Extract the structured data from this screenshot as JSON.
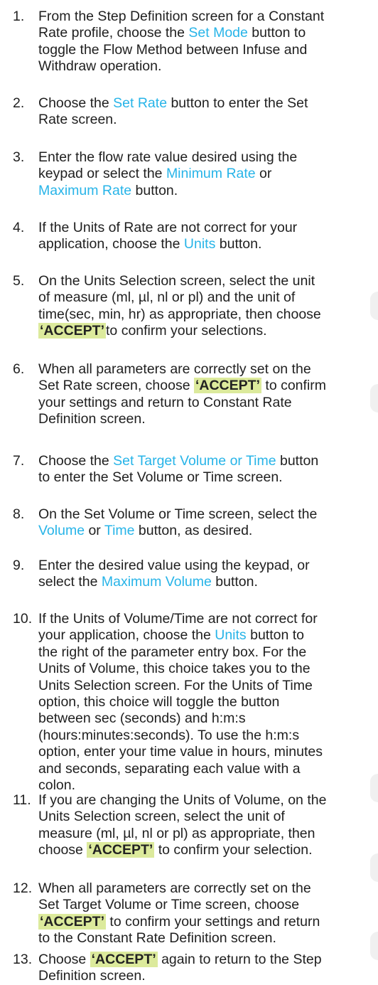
{
  "steps": [
    {
      "num": "1.",
      "lines": [
        [
          {
            "t": "From the Step Definition screen for a Constant"
          }
        ],
        [
          {
            "t": "Rate profile, choose the "
          },
          {
            "t": "Set Mode",
            "k": "link"
          },
          {
            "t": " button to"
          }
        ],
        [
          {
            "t": "toggle the Flow Method between Infuse and"
          }
        ],
        [
          {
            "t": "Withdraw operation."
          }
        ]
      ]
    },
    {
      "num": "2.",
      "lines": [
        [
          {
            "t": "Choose the "
          },
          {
            "t": "Set Rate",
            "k": "link"
          },
          {
            "t": " button to enter the Set"
          }
        ],
        [
          {
            "t": "Rate screen."
          }
        ]
      ]
    },
    {
      "num": "3.",
      "lines": [
        [
          {
            "t": "Enter the flow rate value desired using the"
          }
        ],
        [
          {
            "t": "keypad or select the "
          },
          {
            "t": "Minimum Rate",
            "k": "link"
          },
          {
            "t": " or"
          }
        ],
        [
          {
            "t": "Maximum Rate",
            "k": "link"
          },
          {
            "t": " button."
          }
        ]
      ]
    },
    {
      "num": "4.",
      "lines": [
        [
          {
            "t": "If the Units of Rate are not correct for your"
          }
        ],
        [
          {
            "t": "application, choose the "
          },
          {
            "t": "Units",
            "k": "link"
          },
          {
            "t": " button."
          }
        ]
      ]
    },
    {
      "num": "5.",
      "lines": [
        [
          {
            "t": "On the Units Selection screen, select the unit"
          }
        ],
        [
          {
            "t": "of   measure (ml, µl, nl or pl) and the unit of"
          }
        ],
        [
          {
            "t": "time(sec, min, hr) as appropriate, then choose"
          }
        ],
        [
          {
            "t": "‘ACCEPT’",
            "k": "accept"
          },
          {
            "t": "to confirm your selections."
          }
        ]
      ]
    },
    {
      "num": "6.",
      "lines": [
        [
          {
            "t": "When all parameters are correctly set on the"
          }
        ],
        [
          {
            "t": "Set Rate screen, choose "
          },
          {
            "t": "‘ACCEPT’",
            "k": "accept"
          },
          {
            "t": " to confirm"
          }
        ],
        [
          {
            "t": "your settings and return to Constant Rate"
          }
        ],
        [
          {
            "t": "Definition screen."
          }
        ]
      ]
    },
    {
      "num": "7.",
      "lines": [
        [
          {
            "t": "Choose the "
          },
          {
            "t": "Set Target Volume or Time",
            "k": "link"
          },
          {
            "t": " button"
          }
        ],
        [
          {
            "t": "to enter the Set Volume or Time screen."
          }
        ]
      ]
    },
    {
      "num": "8.",
      "lines": [
        [
          {
            "t": "On the Set Volume or Time screen, select the"
          }
        ],
        [
          {
            "t": "Volume",
            "k": "link"
          },
          {
            "t": " or "
          },
          {
            "t": "Time",
            "k": "link"
          },
          {
            "t": " button, as desired."
          }
        ]
      ]
    },
    {
      "num": "9.",
      "lines": [
        [
          {
            "t": "Enter the desired value using the keypad, or"
          }
        ],
        [
          {
            "t": "select the "
          },
          {
            "t": "Maximum Volume",
            "k": "link"
          },
          {
            "t": " button."
          }
        ]
      ]
    },
    {
      "num": "10.",
      "lines": [
        [
          {
            "t": "If the Units of Volume/Time are not correct for"
          }
        ],
        [
          {
            "t": "your application, choose the "
          },
          {
            "t": "Units",
            "k": "link"
          },
          {
            "t": " button to"
          }
        ],
        [
          {
            "t": "the right of the parameter entry box. For the"
          }
        ],
        [
          {
            "t": "Units of Volume, this choice takes you to the"
          }
        ],
        [
          {
            "t": "Units Selection screen. For the Units of Time"
          }
        ],
        [
          {
            "t": "option, this choice will toggle the button"
          }
        ],
        [
          {
            "t": "between sec (seconds) and h:m:s"
          }
        ],
        [
          {
            "t": "(hours:minutes:seconds). To use the h:m:s"
          }
        ],
        [
          {
            "t": "option, enter your time value in hours, minutes"
          }
        ],
        [
          {
            "t": "and seconds, separating each value with a"
          }
        ],
        [
          {
            "t": "colon."
          }
        ]
      ]
    },
    {
      "num": "11.",
      "lines": [
        [
          {
            "t": "If you are changing the Units of Volume, on the"
          }
        ],
        [
          {
            "t": "Units Selection screen, select the unit of"
          }
        ],
        [
          {
            "t": "measure (ml, µl, nl or pl) as appropriate, then"
          }
        ],
        [
          {
            "t": "choose "
          },
          {
            "t": "‘ACCEPT’",
            "k": "accept"
          },
          {
            "t": " to confirm your selection."
          }
        ]
      ]
    },
    {
      "num": "12.",
      "lines": [
        [
          {
            "t": "When all parameters are correctly set on the"
          }
        ],
        [
          {
            "t": "Set Target Volume or Time screen, choose"
          }
        ],
        [
          {
            "t": "‘ACCEPT’",
            "k": "accept"
          },
          {
            "t": " to confirm your settings and return"
          }
        ],
        [
          {
            "t": "to the Constant Rate Definition screen."
          }
        ]
      ]
    },
    {
      "num": "13.",
      "lines": [
        [
          {
            "t": "Choose "
          },
          {
            "t": "‘ACCEPT’",
            "k": "accept"
          },
          {
            "t": " again to return to the Step"
          }
        ],
        [
          {
            "t": "Definition screen."
          }
        ]
      ]
    }
  ]
}
